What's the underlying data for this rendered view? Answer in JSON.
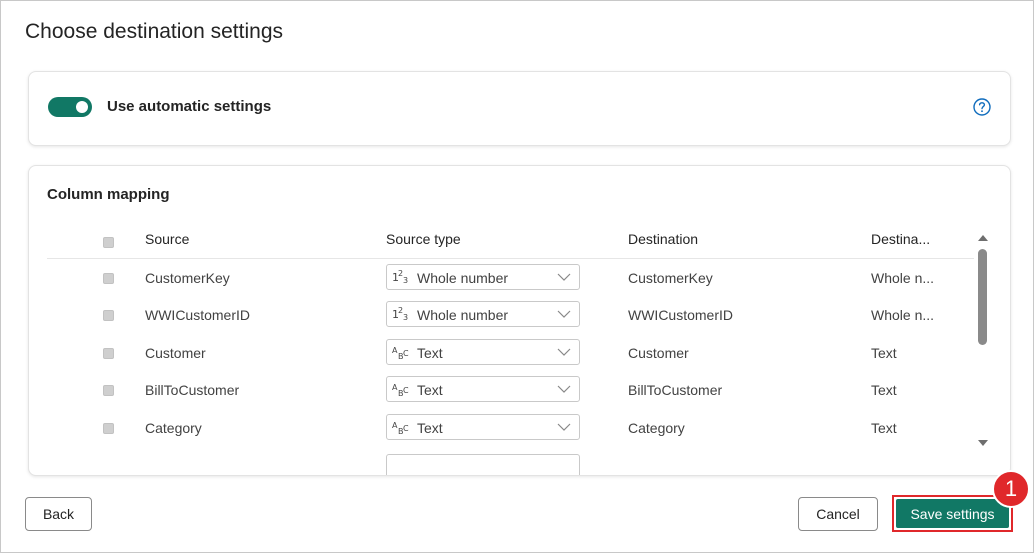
{
  "dialog": {
    "title": "Choose destination settings"
  },
  "auto_settings": {
    "label": "Use automatic settings",
    "enabled": true,
    "help_icon": "help-circle-icon"
  },
  "column_mapping": {
    "title": "Column mapping",
    "headers": {
      "source": "Source",
      "source_type": "Source type",
      "destination": "Destination",
      "destination_type": "Destina..."
    },
    "rows": [
      {
        "source": "CustomerKey",
        "source_type": "Whole number",
        "type_icon": "123",
        "destination": "CustomerKey",
        "destination_type": "Whole n..."
      },
      {
        "source": "WWICustomerID",
        "source_type": "Whole number",
        "type_icon": "123",
        "destination": "WWICustomerID",
        "destination_type": "Whole n..."
      },
      {
        "source": "Customer",
        "source_type": "Text",
        "type_icon": "ABC",
        "destination": "Customer",
        "destination_type": "Text"
      },
      {
        "source": "BillToCustomer",
        "source_type": "Text",
        "type_icon": "ABC",
        "destination": "BillToCustomer",
        "destination_type": "Text"
      },
      {
        "source": "Category",
        "source_type": "Text",
        "type_icon": "ABC",
        "destination": "Category",
        "destination_type": "Text"
      }
    ]
  },
  "footer": {
    "back_label": "Back",
    "cancel_label": "Cancel",
    "save_label": "Save settings",
    "step_number": "1"
  },
  "colors": {
    "accent": "#117865",
    "highlight": "#e0282b"
  }
}
